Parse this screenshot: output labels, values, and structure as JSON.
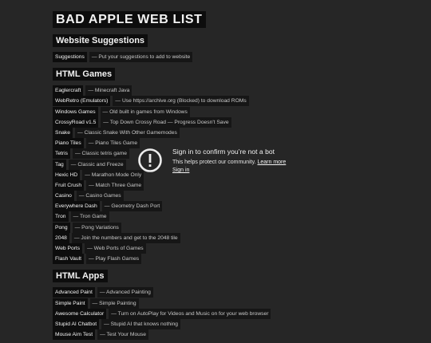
{
  "title": "BAD APPLE WEB LIST",
  "sections": [
    {
      "heading": "Website Suggestions",
      "items": [
        {
          "name": "Suggestions",
          "desc": "— Put your suggestions to add to website"
        }
      ]
    },
    {
      "heading": "HTML Games",
      "items": [
        {
          "name": "Eaglercraft",
          "desc": "— Minecraft Java"
        },
        {
          "name": "WebRetro (Emulators)",
          "desc": "— Use https://archive.org (Blocked) to download ROMs"
        },
        {
          "name": "Windows Games",
          "desc": "— Old built in games from Windows"
        },
        {
          "name": "CrossyRoad v1.5",
          "desc": "— Top Down Crossy Road — Progress Doesn't Save"
        },
        {
          "name": "Snake",
          "desc": "— Classic Snake With Other Gamemodes"
        },
        {
          "name": "Piano Tiles",
          "desc": "— Piano Tiles Game"
        },
        {
          "name": "Tetris",
          "desc": "— Classic tetris game"
        },
        {
          "name": "Tag",
          "desc": "— Classic and Freeze"
        },
        {
          "name": "Hexic HD",
          "desc": "— Marathon Mode Only"
        },
        {
          "name": "Fruit Crush",
          "desc": "— Match Three Game"
        },
        {
          "name": "Casino",
          "desc": "— Casino Games"
        },
        {
          "name": "Everywhere Dash",
          "desc": "— Geometry Dash Port"
        },
        {
          "name": "Tron",
          "desc": "— Tron Game"
        },
        {
          "name": "Pong",
          "desc": "— Pong Variations"
        },
        {
          "name": "2048",
          "desc": "— Join the numbers and get to the 2048 tile"
        },
        {
          "name": "Web Ports",
          "desc": "— Web Ports of Games"
        },
        {
          "name": "Flash Vault",
          "desc": "— Play Flash Games"
        }
      ]
    },
    {
      "heading": "HTML Apps",
      "items": [
        {
          "name": "Advanced Paint",
          "desc": "— Advanced Painting"
        },
        {
          "name": "Simple Paint",
          "desc": "— Simple Painting"
        },
        {
          "name": "Awesome Calculator",
          "desc": "— Turn on AutoPlay for Videos and Music on for your web browser"
        },
        {
          "name": "Stupid AI Chatbot",
          "desc": "— Stupid AI that knows nothing"
        },
        {
          "name": "Mouse Aim Test",
          "desc": "— Test Your Mouse"
        }
      ]
    }
  ],
  "overlay": {
    "icon": "exclamation-circle-icon",
    "title": "Sign in to confirm you’re not a bot",
    "text": "This helps protect our community.",
    "learn_more": "Learn more",
    "sign_in": "Sign in"
  }
}
